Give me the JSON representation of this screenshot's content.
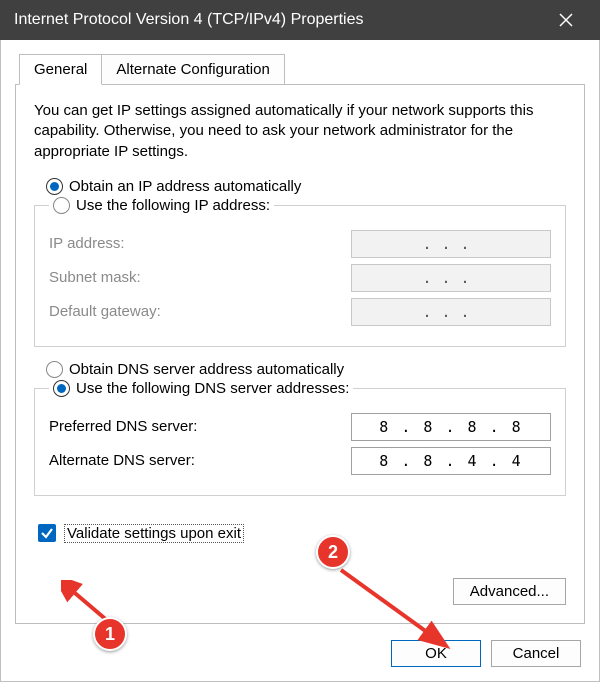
{
  "window": {
    "title": "Internet Protocol Version 4 (TCP/IPv4) Properties"
  },
  "tabs": {
    "general": "General",
    "alternate": "Alternate Configuration"
  },
  "intro": "You can get IP settings assigned automatically if your network supports this capability. Otherwise, you need to ask your network administrator for the appropriate IP settings.",
  "ip": {
    "auto": "Obtain an IP address automatically",
    "manual": "Use the following IP address:",
    "address_label": "IP address:",
    "subnet_label": "Subnet mask:",
    "gateway_label": "Default gateway:"
  },
  "dns": {
    "auto": "Obtain DNS server address automatically",
    "manual": "Use the following DNS server addresses:",
    "preferred_label": "Preferred DNS server:",
    "alternate_label": "Alternate DNS server:",
    "preferred_value": "8 . 8 . 8 . 8",
    "alternate_value": "8 . 8 . 4 . 4"
  },
  "validate": "Validate settings upon exit",
  "buttons": {
    "advanced": "Advanced...",
    "ok": "OK",
    "cancel": "Cancel"
  },
  "callouts": {
    "one": "1",
    "two": "2"
  }
}
